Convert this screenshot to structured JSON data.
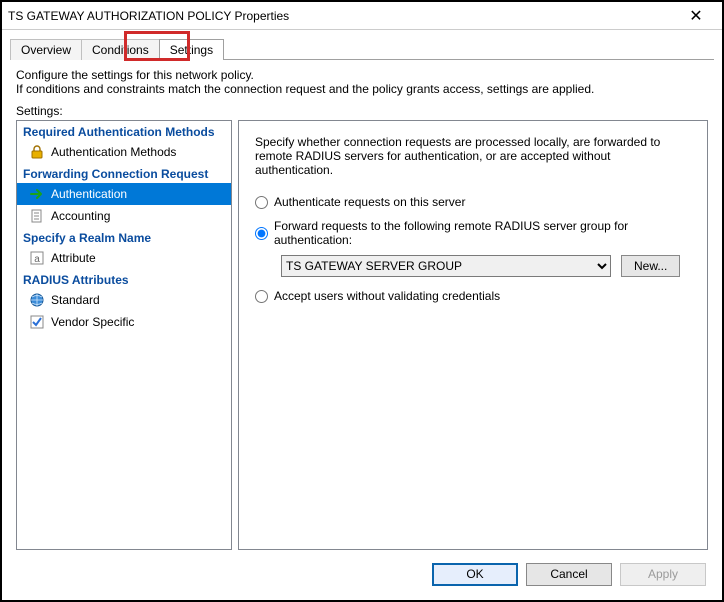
{
  "window": {
    "title": "TS GATEWAY AUTHORIZATION POLICY Properties"
  },
  "tabs": {
    "overview": "Overview",
    "conditions": "Conditions",
    "settings": "Settings"
  },
  "intro": {
    "line1": "Configure the settings for this network policy.",
    "line2": "If conditions and constraints match the connection request and the policy grants access, settings are applied."
  },
  "settings_label": "Settings:",
  "tree": {
    "groups": [
      {
        "header": "Required Authentication Methods",
        "items": [
          {
            "id": "auth-methods",
            "label": "Authentication Methods",
            "icon": "lock-icon"
          }
        ]
      },
      {
        "header": "Forwarding Connection Request",
        "items": [
          {
            "id": "authentication",
            "label": "Authentication",
            "icon": "arrow-icon",
            "selected": true
          },
          {
            "id": "accounting",
            "label": "Accounting",
            "icon": "doc-icon"
          }
        ]
      },
      {
        "header": "Specify a Realm Name",
        "items": [
          {
            "id": "attribute",
            "label": "Attribute",
            "icon": "attr-icon"
          }
        ]
      },
      {
        "header": "RADIUS Attributes",
        "items": [
          {
            "id": "standard",
            "label": "Standard",
            "icon": "globe-icon"
          },
          {
            "id": "vendor",
            "label": "Vendor Specific",
            "icon": "check-icon"
          }
        ]
      }
    ]
  },
  "content": {
    "description": "Specify whether connection requests are processed locally, are forwarded to remote RADIUS servers for authentication, or are accepted without authentication.",
    "radio_local": "Authenticate requests on this server",
    "radio_forward": "Forward requests to the following remote RADIUS server group for authentication:",
    "radio_accept": "Accept users without validating credentials",
    "server_group_selected": "TS GATEWAY SERVER GROUP",
    "new_button": "New...",
    "selected_radio": "forward"
  },
  "footer": {
    "ok": "OK",
    "cancel": "Cancel",
    "apply": "Apply"
  }
}
